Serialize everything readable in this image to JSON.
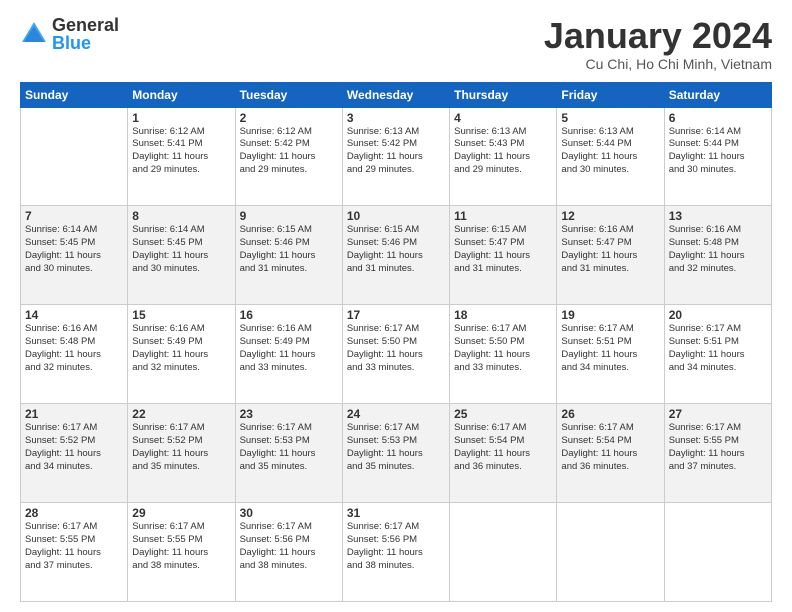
{
  "header": {
    "logo_general": "General",
    "logo_blue": "Blue",
    "title": "January 2024",
    "location": "Cu Chi, Ho Chi Minh, Vietnam"
  },
  "calendar": {
    "days_of_week": [
      "Sunday",
      "Monday",
      "Tuesday",
      "Wednesday",
      "Thursday",
      "Friday",
      "Saturday"
    ],
    "weeks": [
      [
        {
          "day": "",
          "info": ""
        },
        {
          "day": "1",
          "info": "Sunrise: 6:12 AM\nSunset: 5:41 PM\nDaylight: 11 hours\nand 29 minutes."
        },
        {
          "day": "2",
          "info": "Sunrise: 6:12 AM\nSunset: 5:42 PM\nDaylight: 11 hours\nand 29 minutes."
        },
        {
          "day": "3",
          "info": "Sunrise: 6:13 AM\nSunset: 5:42 PM\nDaylight: 11 hours\nand 29 minutes."
        },
        {
          "day": "4",
          "info": "Sunrise: 6:13 AM\nSunset: 5:43 PM\nDaylight: 11 hours\nand 29 minutes."
        },
        {
          "day": "5",
          "info": "Sunrise: 6:13 AM\nSunset: 5:44 PM\nDaylight: 11 hours\nand 30 minutes."
        },
        {
          "day": "6",
          "info": "Sunrise: 6:14 AM\nSunset: 5:44 PM\nDaylight: 11 hours\nand 30 minutes."
        }
      ],
      [
        {
          "day": "7",
          "info": "Sunrise: 6:14 AM\nSunset: 5:45 PM\nDaylight: 11 hours\nand 30 minutes."
        },
        {
          "day": "8",
          "info": "Sunrise: 6:14 AM\nSunset: 5:45 PM\nDaylight: 11 hours\nand 30 minutes."
        },
        {
          "day": "9",
          "info": "Sunrise: 6:15 AM\nSunset: 5:46 PM\nDaylight: 11 hours\nand 31 minutes."
        },
        {
          "day": "10",
          "info": "Sunrise: 6:15 AM\nSunset: 5:46 PM\nDaylight: 11 hours\nand 31 minutes."
        },
        {
          "day": "11",
          "info": "Sunrise: 6:15 AM\nSunset: 5:47 PM\nDaylight: 11 hours\nand 31 minutes."
        },
        {
          "day": "12",
          "info": "Sunrise: 6:16 AM\nSunset: 5:47 PM\nDaylight: 11 hours\nand 31 minutes."
        },
        {
          "day": "13",
          "info": "Sunrise: 6:16 AM\nSunset: 5:48 PM\nDaylight: 11 hours\nand 32 minutes."
        }
      ],
      [
        {
          "day": "14",
          "info": "Sunrise: 6:16 AM\nSunset: 5:48 PM\nDaylight: 11 hours\nand 32 minutes."
        },
        {
          "day": "15",
          "info": "Sunrise: 6:16 AM\nSunset: 5:49 PM\nDaylight: 11 hours\nand 32 minutes."
        },
        {
          "day": "16",
          "info": "Sunrise: 6:16 AM\nSunset: 5:49 PM\nDaylight: 11 hours\nand 33 minutes."
        },
        {
          "day": "17",
          "info": "Sunrise: 6:17 AM\nSunset: 5:50 PM\nDaylight: 11 hours\nand 33 minutes."
        },
        {
          "day": "18",
          "info": "Sunrise: 6:17 AM\nSunset: 5:50 PM\nDaylight: 11 hours\nand 33 minutes."
        },
        {
          "day": "19",
          "info": "Sunrise: 6:17 AM\nSunset: 5:51 PM\nDaylight: 11 hours\nand 34 minutes."
        },
        {
          "day": "20",
          "info": "Sunrise: 6:17 AM\nSunset: 5:51 PM\nDaylight: 11 hours\nand 34 minutes."
        }
      ],
      [
        {
          "day": "21",
          "info": "Sunrise: 6:17 AM\nSunset: 5:52 PM\nDaylight: 11 hours\nand 34 minutes."
        },
        {
          "day": "22",
          "info": "Sunrise: 6:17 AM\nSunset: 5:52 PM\nDaylight: 11 hours\nand 35 minutes."
        },
        {
          "day": "23",
          "info": "Sunrise: 6:17 AM\nSunset: 5:53 PM\nDaylight: 11 hours\nand 35 minutes."
        },
        {
          "day": "24",
          "info": "Sunrise: 6:17 AM\nSunset: 5:53 PM\nDaylight: 11 hours\nand 35 minutes."
        },
        {
          "day": "25",
          "info": "Sunrise: 6:17 AM\nSunset: 5:54 PM\nDaylight: 11 hours\nand 36 minutes."
        },
        {
          "day": "26",
          "info": "Sunrise: 6:17 AM\nSunset: 5:54 PM\nDaylight: 11 hours\nand 36 minutes."
        },
        {
          "day": "27",
          "info": "Sunrise: 6:17 AM\nSunset: 5:55 PM\nDaylight: 11 hours\nand 37 minutes."
        }
      ],
      [
        {
          "day": "28",
          "info": "Sunrise: 6:17 AM\nSunset: 5:55 PM\nDaylight: 11 hours\nand 37 minutes."
        },
        {
          "day": "29",
          "info": "Sunrise: 6:17 AM\nSunset: 5:55 PM\nDaylight: 11 hours\nand 38 minutes."
        },
        {
          "day": "30",
          "info": "Sunrise: 6:17 AM\nSunset: 5:56 PM\nDaylight: 11 hours\nand 38 minutes."
        },
        {
          "day": "31",
          "info": "Sunrise: 6:17 AM\nSunset: 5:56 PM\nDaylight: 11 hours\nand 38 minutes."
        },
        {
          "day": "",
          "info": ""
        },
        {
          "day": "",
          "info": ""
        },
        {
          "day": "",
          "info": ""
        }
      ]
    ],
    "row_shading": [
      false,
      true,
      false,
      true,
      false
    ]
  }
}
